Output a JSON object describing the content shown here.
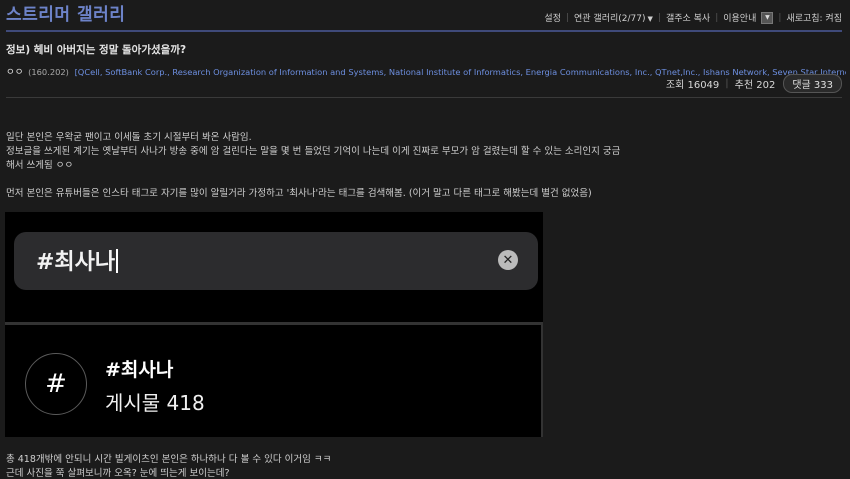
{
  "header": {
    "gallery_title": "스트리머 갤러리",
    "menu": {
      "settings": "설정",
      "related_galleries": "연관 갤러리(2/77)",
      "copy_address": "갤주소 복사",
      "guide": "이용안내",
      "dropdown_glyph": "▼",
      "auto_refresh": "새로고침: 켜짐"
    }
  },
  "post": {
    "title": "정보) 헤비 아버지는 정말 돌아가셨을까?",
    "author": "ㅇㅇ",
    "ip": "(160.202)",
    "isp_list": "[QCell, SoftBank Corp., Research Organization of Information and Systems, National Institute of Informatics, Energia Communications, Inc., QTnet,Inc., Ishans Network, Seven Star Internet Service Provider, GlobalConnect A",
    "views_label": "조회 16049",
    "recommend_label": "추천 202",
    "comments_label": "댓글 333",
    "paragraphs": [
      "일단 본인은 우왁굳 팬이고 이세돌 초기 시절부터 봐온 사람임.",
      "정보글을 쓰게된 계기는 옛날부터 사나가 방송 중에 암 걸린다는 말을 몇 번 들었던 기억이 나는데 이게 진짜로 부모가 암 걸렸는데 할 수 있는 소리인지 궁금",
      "해서 쓰게됨 ㅇㅇ",
      "먼저 본인은 유튜버들은 인스타 태그로 자기를 많이 알릴거라 가정하고 '최사나'라는 태그를 검색해봄. (이거 말고 다른 태그로 해봤는데 별건 없었음)",
      "총 418개밖에 안되니 시간 빌게이츠인 본인은 하나하나 다 볼 수 있다 이거임 ㅋㅋ",
      "근데 사진을 쭉 살펴보니까 오옥? 눈에 띄는게 보이는데?"
    ],
    "image": {
      "search_query": "#최사나",
      "clear_glyph": "✕",
      "hash_glyph": "#",
      "tag_name": "#최사나",
      "tag_count": "게시물 418"
    }
  }
}
